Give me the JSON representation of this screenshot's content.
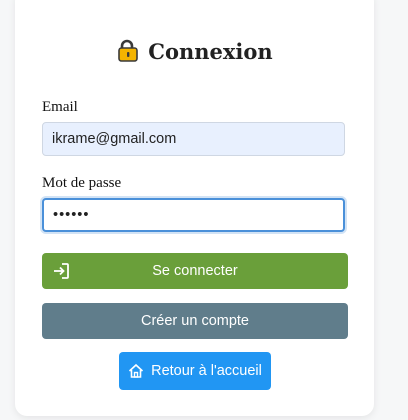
{
  "form": {
    "title": "Connexion",
    "title_icon": "lock-icon",
    "email_label": "Email",
    "email_value": "ikrame@gmail.com",
    "password_label": "Mot de passe",
    "password_value": "••••••"
  },
  "buttons": {
    "login_label": "Se connecter",
    "login_icon": "sign-in-icon",
    "create_label": "Créer un compte",
    "home_label": "Retour à l'accueil",
    "home_icon": "home-icon"
  },
  "colors": {
    "login": "#6a9f3a",
    "create": "#607d8b",
    "home": "#2196f3",
    "email_bg": "#e8f0fe",
    "focus_border": "#4a90d9"
  }
}
